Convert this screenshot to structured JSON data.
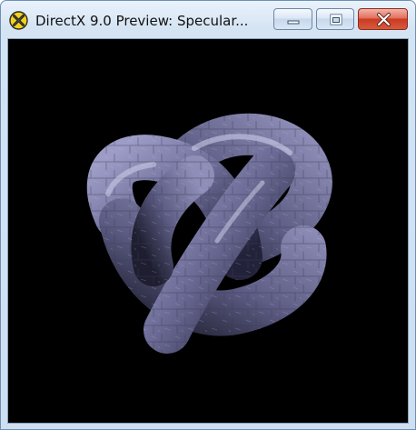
{
  "window": {
    "title": "DirectX 9.0 Preview: Specular...",
    "icon": "directx-x-icon",
    "controls": {
      "minimize": "minimize-icon",
      "maximize": "maximize-icon",
      "close": "close-icon"
    }
  },
  "viewport": {
    "background": "#000000",
    "subject": "torus-knot-icon",
    "surface_color": "#6f6f9a"
  }
}
